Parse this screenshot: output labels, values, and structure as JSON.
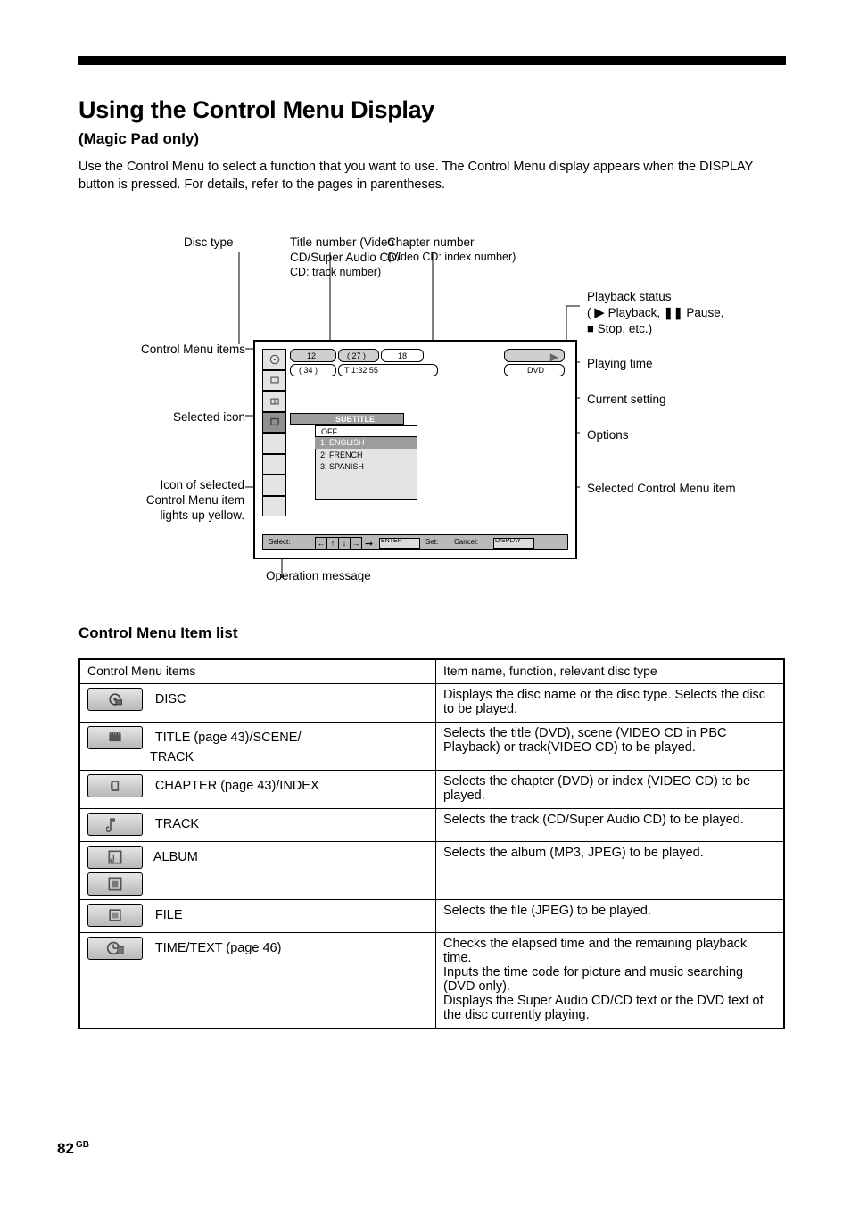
{
  "page_number": "82",
  "page_number_suffix": "GB",
  "heading": "Using the Control Menu Display",
  "subheading": "(Magic Pad only)",
  "intro_para": "Use the Control Menu to select a function that you want to use. The Control Menu display appears when the DISPLAY button is pressed. For details, refer to the pages in parentheses.",
  "callouts": {
    "disctype": "Disc type",
    "titlenum": {
      "line1": "Title number (Video CD/Super Audio CD/",
      "line2": "CD: track number)"
    },
    "chapnum": {
      "line1": "Chapter number",
      "line2": "(Video CD: index number)"
    },
    "status": {
      "line1": "Playback status",
      "line2a": "(",
      "play_word": "Playback, ",
      "pause_word": "Pause,",
      "line3": "Stop, etc.)"
    },
    "time": "Playing time",
    "setting": "Current setting",
    "options": "Options",
    "selitem": "Selected Control Menu item",
    "ops": "Operation message",
    "icons": "Control Menu items",
    "selicon": "Selected icon",
    "iconexp": {
      "l1": "Icon of selected",
      "l2": "Control Menu item",
      "l3": "lights up yellow."
    }
  },
  "tv": {
    "titlenum": "12",
    "titletot": "( 27 )",
    "chapnum": "18",
    "chaptot": "( 34 )",
    "time": "T          1:32:55",
    "disc": "DVD",
    "set_item": "SUBTITLE",
    "opt_off": "OFF",
    "opt_sel": "1: ENGLISH",
    "opt2": "2: FRENCH",
    "opt3": "3: SPANISH",
    "bottom_select": "Select:",
    "bottom_set": "Set:",
    "bottom_cancel": "Cancel:",
    "bottom_enter": "ENTER",
    "bottom_display": "DISPLAY"
  },
  "table": {
    "h1": "Control Menu items",
    "h2": "Item name, function, relevant disc type",
    "rows": [
      {
        "icon": "disc",
        "label": "DISC",
        "explain": "Displays the disc name or the disc type. Selects the disc to be played."
      },
      {
        "icon": "title",
        "label_a": "TITLE (page 43)/SCENE/",
        "label_b": "TRACK",
        "explain": "Selects the title (DVD), scene (VIDEO CD in PBC Playback) or track(VIDEO CD) to be played."
      },
      {
        "icon": "chapter",
        "label": "CHAPTER (page 43)/INDEX",
        "explain": "Selects the chapter (DVD) or index (VIDEO CD) to be played."
      },
      {
        "icon": "track",
        "label": "TRACK",
        "explain": "Selects the track (CD/Super Audio CD) to be played."
      },
      {
        "icon": "album",
        "label": "ALBUM",
        "explain": "Selects the album (MP3, JPEG) to be played."
      },
      {
        "icon": "file",
        "label": "FILE",
        "explain": "Selects the file (JPEG) to be played."
      },
      {
        "icon": "time",
        "label": "TIME/TEXT (page 46)",
        "explain_lines": [
          "Checks the elapsed time and the remaining playback time.",
          "Inputs the time code for picture and music searching (DVD only).",
          "Displays the Super Audio CD/CD text or the DVD text of the disc currently playing."
        ]
      }
    ]
  },
  "section2": "Control Menu Item list"
}
